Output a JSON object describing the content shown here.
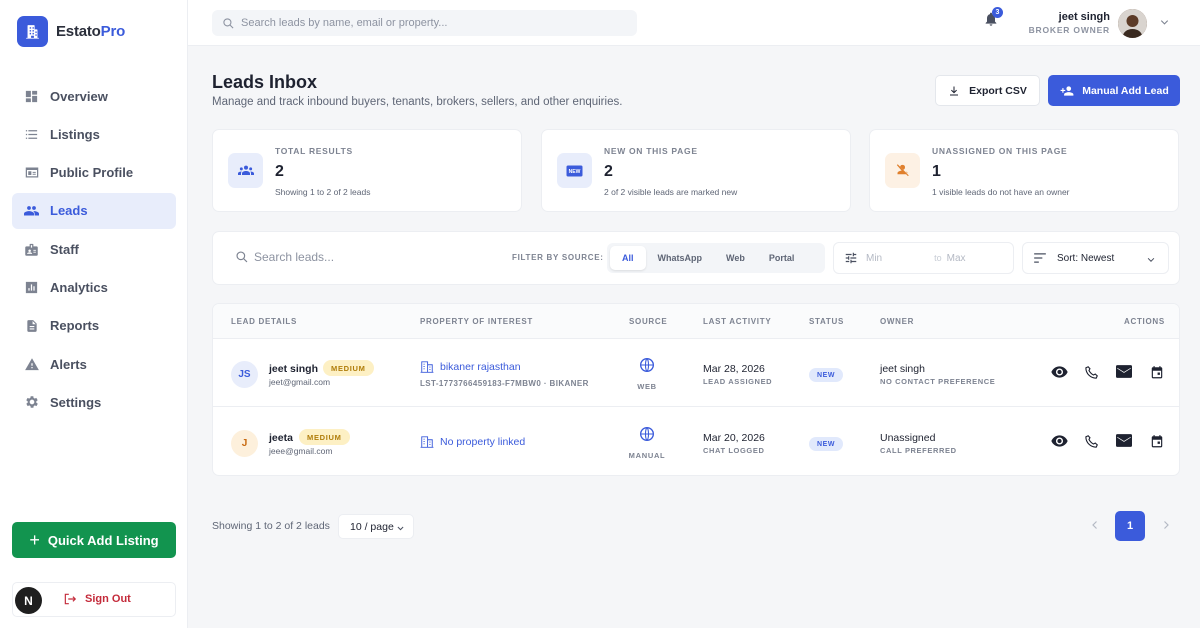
{
  "brand": {
    "name_a": "Estato",
    "name_b": "Pro"
  },
  "sidebar": {
    "items": [
      {
        "label": "Overview",
        "icon": "dashboard-icon",
        "active": false
      },
      {
        "label": "Listings",
        "icon": "list-icon",
        "active": false
      },
      {
        "label": "Public Profile",
        "icon": "profile-card-icon",
        "active": false
      },
      {
        "label": "Leads",
        "icon": "people-icon",
        "active": true
      },
      {
        "label": "Staff",
        "icon": "badge-icon",
        "active": false
      },
      {
        "label": "Analytics",
        "icon": "analytics-icon",
        "active": false
      },
      {
        "label": "Reports",
        "icon": "report-icon",
        "active": false
      },
      {
        "label": "Alerts",
        "icon": "alert-icon",
        "active": false
      },
      {
        "label": "Settings",
        "icon": "gear-icon",
        "active": false
      }
    ],
    "quick_add": "Quick Add Listing",
    "sign_out": "Sign Out",
    "avatar_initial": "N"
  },
  "topbar": {
    "search_placeholder": "Search leads by name, email or property...",
    "notification_count": "3",
    "user_name": "jeet singh",
    "user_role": "BROKER OWNER"
  },
  "header": {
    "title": "Leads Inbox",
    "subtitle": "Manage and track inbound buyers, tenants, brokers, sellers, and other enquiries.",
    "export_label": "Export CSV",
    "manual_label": "Manual Add Lead"
  },
  "stats": [
    {
      "label": "TOTAL RESULTS",
      "value": "2",
      "note": "Showing 1 to 2 of 2 leads",
      "icon": "group-icon"
    },
    {
      "label": "NEW ON THIS PAGE",
      "value": "2",
      "note": "2 of 2 visible leads are marked new",
      "icon": "new-badge-icon"
    },
    {
      "label": "UNASSIGNED ON THIS PAGE",
      "value": "1",
      "note": "1 visible leads do not have an owner",
      "icon": "person-off-icon"
    }
  ],
  "filters": {
    "search_placeholder": "Search leads...",
    "source_label": "FILTER BY SOURCE:",
    "sources": [
      "All",
      "WhatsApp",
      "Web",
      "Portal"
    ],
    "active_source": "All",
    "min_placeholder": "Min",
    "to_label": "to",
    "max_placeholder": "Max",
    "sort_label": "Sort: Newest"
  },
  "table": {
    "headers": {
      "lead": "LEAD DETAILS",
      "property": "PROPERTY OF INTEREST",
      "source": "SOURCE",
      "activity": "LAST ACTIVITY",
      "status": "STATUS",
      "owner": "OWNER",
      "actions": "ACTIONS"
    },
    "rows": [
      {
        "initials": "JS",
        "name": "jeet singh",
        "priority": "MEDIUM",
        "email": "jeet@gmail.com",
        "property": "bikaner rajasthan",
        "property_id": "LST-1773766459183-F7MBW0 · BIKANER",
        "source": "WEB",
        "date": "Mar 28, 2026",
        "activity": "LEAD ASSIGNED",
        "status": "NEW",
        "owner": "jeet singh",
        "owner_note": "NO CONTACT PREFERENCE"
      },
      {
        "initials": "J",
        "name": "jeeta",
        "priority": "MEDIUM",
        "email": "jeee@gmail.com",
        "property": "No property linked",
        "property_id": "",
        "source": "MANUAL",
        "date": "Mar 20, 2026",
        "activity": "CHAT LOGGED",
        "status": "NEW",
        "owner": "Unassigned",
        "owner_note": "CALL PREFERRED"
      }
    ]
  },
  "pagination": {
    "summary": "Showing 1 to 2 of 2 leads",
    "page_size": "10 / page",
    "current_page": "1"
  },
  "colors": {
    "accent": "#3b5bdb",
    "success": "#12944f",
    "danger": "#c42a3a",
    "warning_bg": "#fdf0c4"
  }
}
